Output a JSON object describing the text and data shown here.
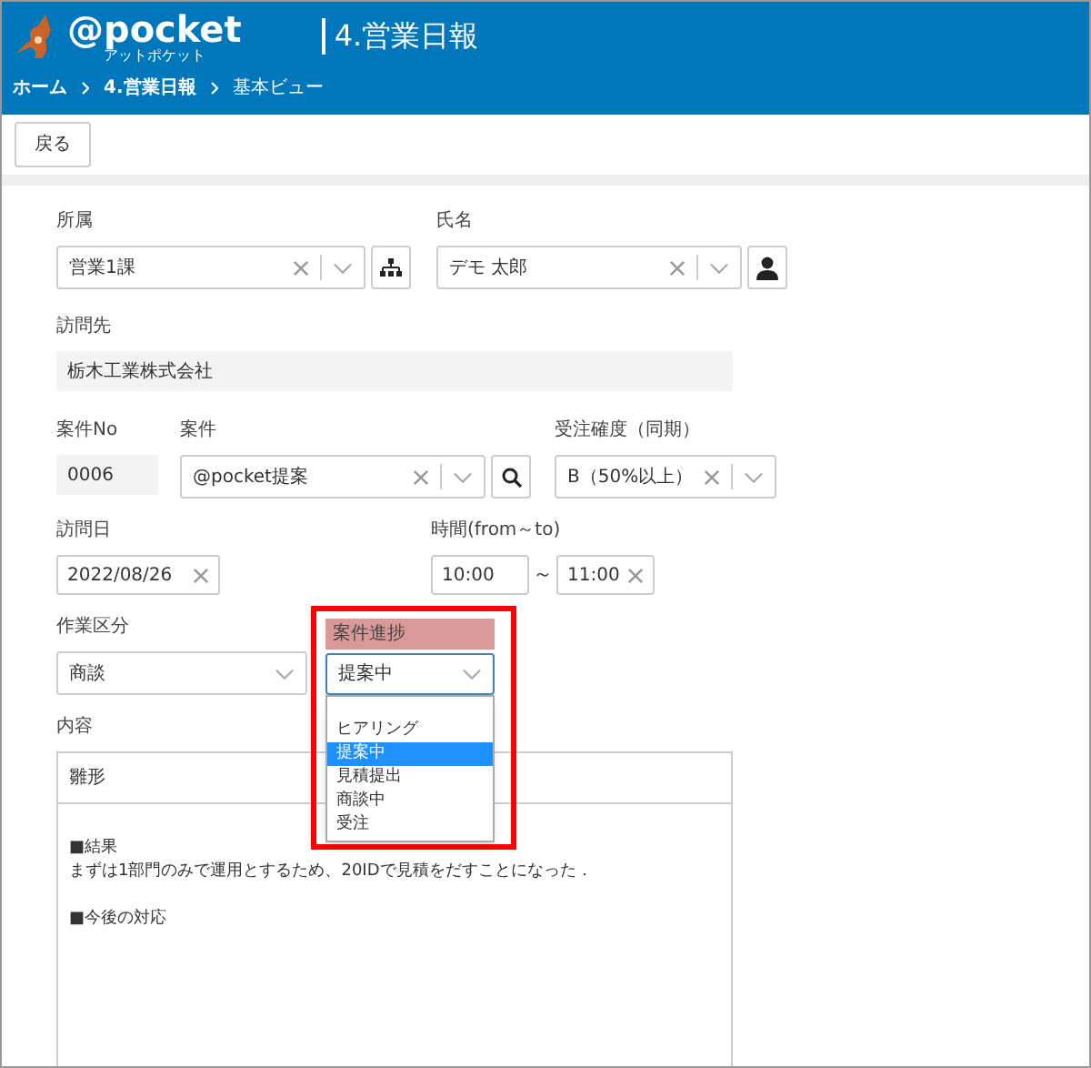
{
  "header": {
    "logo_text": "@pocket",
    "logo_subtext": "アットポケット",
    "title": "4.営業日報"
  },
  "breadcrumb": [
    "ホーム",
    "4.営業日報",
    "基本ビュー"
  ],
  "toolbar": {
    "back_button": "戻る"
  },
  "form": {
    "affiliation": {
      "label": "所属",
      "value": "営業1課"
    },
    "name": {
      "label": "氏名",
      "value": "デモ 太郎"
    },
    "visit_to": {
      "label": "訪問先",
      "value": "栃木工業株式会社"
    },
    "project_no": {
      "label": "案件No",
      "value": "0006"
    },
    "project": {
      "label": "案件",
      "value": "@pocket提案"
    },
    "order_probability": {
      "label": "受注確度（同期）",
      "value": "B（50%以上）"
    },
    "visit_date": {
      "label": "訪問日",
      "value": "2022/08/26"
    },
    "time": {
      "label": "時間(from～to)",
      "from": "10:00",
      "separator": "～",
      "to": "11:00"
    },
    "work_type": {
      "label": "作業区分",
      "value": "商談"
    },
    "progress": {
      "label": "案件進捗",
      "value": "提案中",
      "highlighted": true,
      "expanded": true,
      "options": [
        {
          "label": "ヒアリング",
          "selected": false
        },
        {
          "label": "提案中",
          "selected": true
        },
        {
          "label": "見積提出",
          "selected": false
        },
        {
          "label": "商談中",
          "selected": false
        },
        {
          "label": "受注",
          "selected": false
        }
      ]
    },
    "content": {
      "label": "内容",
      "template": "雛形",
      "sections": [
        {
          "heading": "■結果",
          "body": [
            "まずは1部門のみで運用とするため、20IDで見積をだすことになった．"
          ]
        },
        {
          "heading": "■今後の対応"
        }
      ]
    }
  }
}
